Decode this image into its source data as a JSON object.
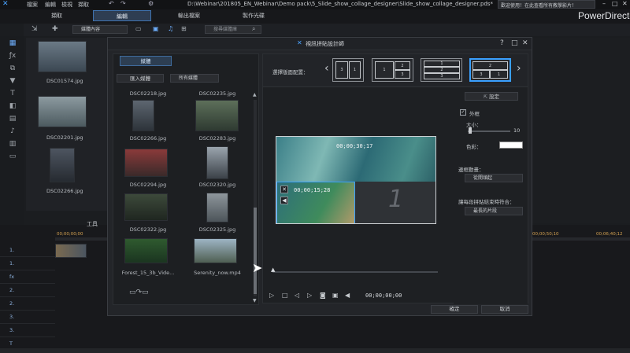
{
  "app": {
    "menu": [
      "檔案",
      "編輯",
      "檢視",
      "擷取"
    ],
    "path_title": "D:\\Webinar\\201805_EN_Webinar\\Demo pack\\5_Slide_show_collage_designer\\Slide_show_collage_designer.pds*",
    "notification": "歡迎使用！在此查看所有教學影片！",
    "brand": "PowerDirector",
    "win_controls": [
      "–",
      "□",
      "✕"
    ]
  },
  "modes": [
    {
      "label": "擷取",
      "active": false
    },
    {
      "label": "編輯",
      "active": true
    },
    {
      "label": "輸出檔案",
      "active": false
    },
    {
      "label": "製作光碟",
      "active": false
    }
  ],
  "toolbar2": {
    "media_filter": "媒體內容",
    "search_placeholder": "搜尋媒體庫"
  },
  "library": {
    "items": [
      {
        "label": "DSC01574.jpg"
      },
      {
        "label": "DSC02201.jpg"
      },
      {
        "label": "DSC02266.jpg"
      }
    ]
  },
  "timeline": {
    "tools_label": "工具",
    "timecode_left": "00;00;00;00",
    "timecode_mid": "00;00;50;10",
    "timecode_right": "00;06;40;12",
    "tracks": [
      "1.",
      "1.",
      "fx",
      "2.",
      "2.",
      "3.",
      "3.",
      "T"
    ]
  },
  "dialog": {
    "title": "視訊拼貼設計師",
    "controls": [
      "?",
      "□",
      "✕"
    ],
    "media_tab": "媒體",
    "import_btn": "匯入媒體",
    "filter_select": "所有媒體",
    "media": [
      {
        "label": "DSC02218.jpg"
      },
      {
        "label": "DSC02235.jpg"
      },
      {
        "label": "DSC02266.jpg"
      },
      {
        "label": "DSC02283.jpg"
      },
      {
        "label": "DSC02294.jpg"
      },
      {
        "label": "DSC02320.jpg"
      },
      {
        "label": "DSC02322.jpg"
      },
      {
        "label": "DSC02325.jpg"
      },
      {
        "label": "Forest_15_3b_Vide..."
      },
      {
        "label": "Serenity_now.mp4"
      }
    ],
    "layout_label": "選擇版面配置：",
    "layouts": [
      {
        "cells": [
          "3",
          "1"
        ],
        "selected": false
      },
      {
        "cells": [
          "1",
          "2",
          "3"
        ],
        "selected": false
      },
      {
        "cells": [
          "1",
          "2",
          "3"
        ],
        "selected": false
      },
      {
        "cells": [
          "2",
          "3",
          "1"
        ],
        "selected": true
      }
    ],
    "preview": {
      "tc1": "00;00;30;17",
      "tc2": "00;00;15;28",
      "slot_number": "1"
    },
    "settings": {
      "set_btn": "設定",
      "border_label": "外框",
      "border_checked": true,
      "size_label": "大小：",
      "size_value": "10",
      "size_fraction": 0.1,
      "color_label": "色彩：",
      "color_value": "#ffffff",
      "start_anim_label": "邊框動畫：",
      "start_anim_value": "從開頭起",
      "end_label": "讓每段拼貼結束時符合：",
      "end_value": "最長的片段"
    },
    "playback": {
      "timecode": "00;00;00;00"
    },
    "ok_btn": "確定",
    "cancel_btn": "取消"
  },
  "colors": {
    "accent": "#3aa0ff",
    "bg": "#1b1d20"
  }
}
